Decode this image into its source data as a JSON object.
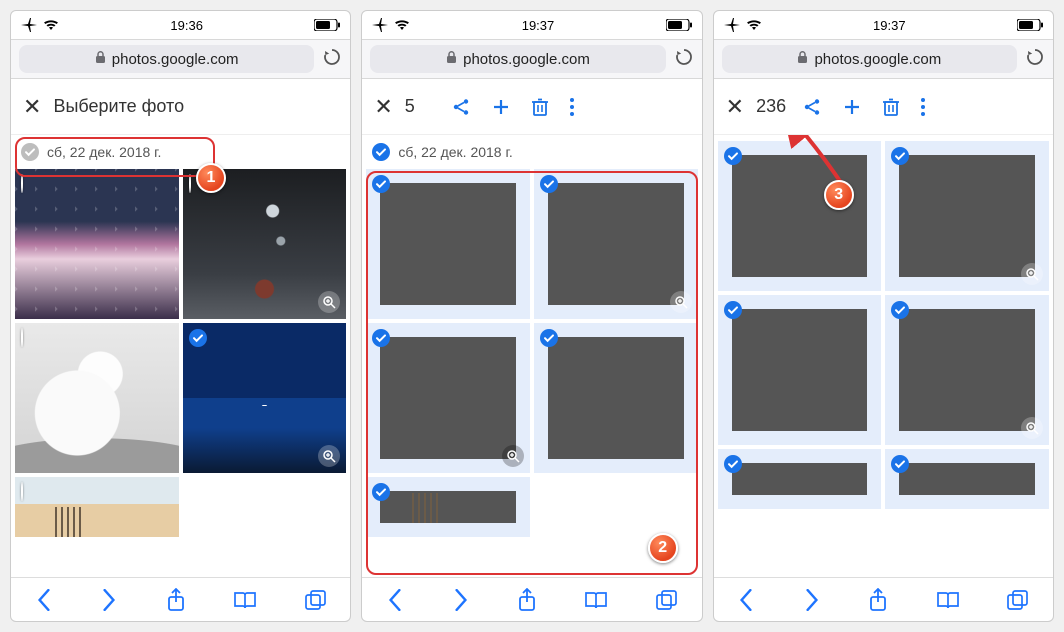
{
  "phones": [
    {
      "status": {
        "time": "19:36"
      },
      "url": "photos.google.com",
      "appbar_mode": "title",
      "title": "Выберите фото",
      "date": "сб, 22 дек. 2018 г.",
      "date_sel": "grey",
      "marker": "1"
    },
    {
      "status": {
        "time": "19:37"
      },
      "url": "photos.google.com",
      "appbar_mode": "count",
      "count": "5",
      "date": "сб, 22 дек. 2018 г.",
      "date_sel": "blue",
      "marker": "2"
    },
    {
      "status": {
        "time": "19:37"
      },
      "url": "photos.google.com",
      "appbar_mode": "count",
      "count": "236",
      "marker": "3"
    }
  ]
}
